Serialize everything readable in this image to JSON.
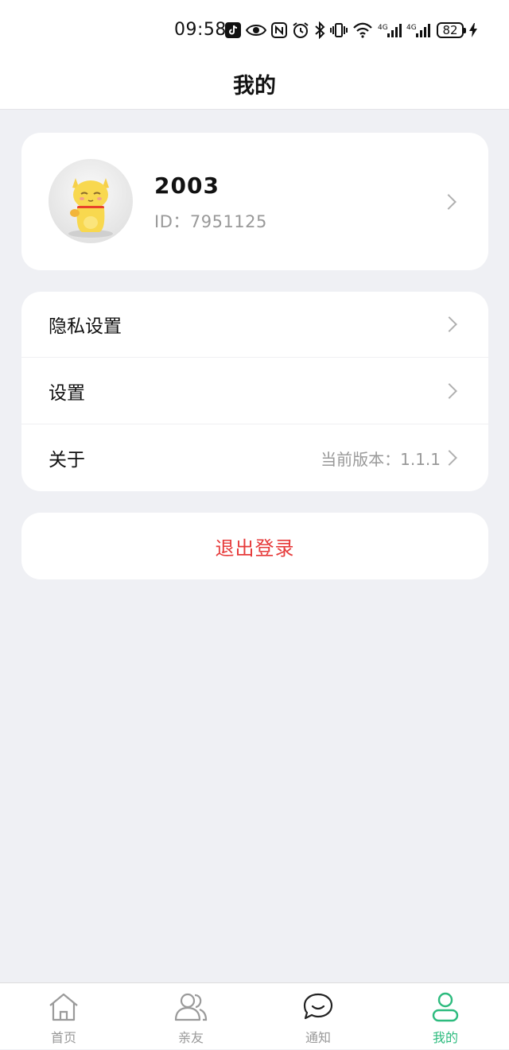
{
  "status_bar": {
    "time": "09:58",
    "battery": "82",
    "icons": [
      "tiktok-icon",
      "eye-icon",
      "nfc-icon",
      "alarm-icon",
      "bluetooth-icon",
      "vibrate-icon",
      "wifi-icon",
      "signal-4g-icon",
      "signal-4g-icon",
      "battery-icon",
      "charging-icon"
    ]
  },
  "header": {
    "title": "我的"
  },
  "profile": {
    "name": "2003",
    "id_text": "ID：7951125"
  },
  "menu": {
    "items": [
      {
        "label": "隐私设置",
        "value": ""
      },
      {
        "label": "设置",
        "value": ""
      },
      {
        "label": "关于",
        "value": "当前版本：1.1.1"
      }
    ]
  },
  "logout": {
    "label": "退出登录"
  },
  "tabs": [
    {
      "label": "首页",
      "icon": "home-icon",
      "active": false
    },
    {
      "label": "亲友",
      "icon": "friends-icon",
      "active": false
    },
    {
      "label": "通知",
      "icon": "chat-icon",
      "active": false
    },
    {
      "label": "我的",
      "icon": "user-icon",
      "active": true
    }
  ],
  "colors": {
    "accent_green": "#2dbb7e",
    "logout_red": "#e63a3a",
    "background": "#eff0f4"
  }
}
